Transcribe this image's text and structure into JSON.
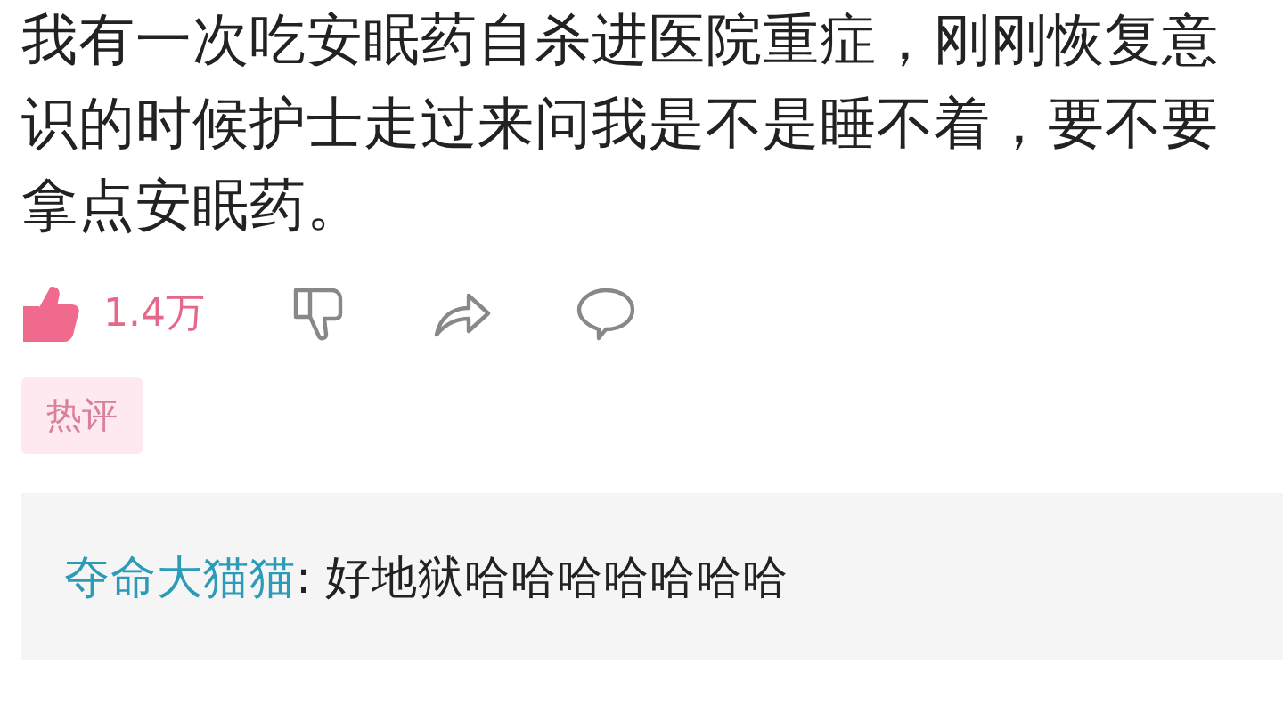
{
  "comment": {
    "body_lines": [
      "我有一次吃安眠药自杀进医院重症，刚刚恢复意",
      "识的时候护士走过来问我是不是睡不着，要不要",
      "拿点安眠药。"
    ],
    "likes": "1.4万",
    "liked": true,
    "tag": "热评"
  },
  "replies": [
    {
      "user": "夺命大猫猫",
      "text": ": 好地狱哈哈哈哈哈哈哈"
    }
  ]
}
